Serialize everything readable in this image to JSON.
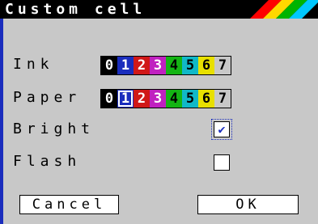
{
  "window": {
    "title": "Custom cell"
  },
  "colors": {
    "background": "#c8c8c8",
    "titlebar": "#000000",
    "accent": "#1a2dbd",
    "stripes": [
      "#ff0000",
      "#ffd800",
      "#00b400",
      "#00c8ff"
    ]
  },
  "ink": {
    "label": "Ink",
    "selected": "0",
    "swatches": [
      {
        "digit": "0",
        "bg": "#000000",
        "fg": "#ffffff"
      },
      {
        "digit": "1",
        "bg": "#1a2dbd",
        "fg": "#ffffff"
      },
      {
        "digit": "2",
        "bg": "#d01818",
        "fg": "#ffffff"
      },
      {
        "digit": "3",
        "bg": "#c020c0",
        "fg": "#ffffff"
      },
      {
        "digit": "4",
        "bg": "#14b414",
        "fg": "#000000"
      },
      {
        "digit": "5",
        "bg": "#10b8c8",
        "fg": "#000000"
      },
      {
        "digit": "6",
        "bg": "#e8e000",
        "fg": "#000000"
      },
      {
        "digit": "7",
        "bg": "#c8c8c8",
        "fg": "#000000"
      }
    ]
  },
  "paper": {
    "label": "Paper",
    "selected": "1",
    "swatches": [
      {
        "digit": "0",
        "bg": "#000000",
        "fg": "#ffffff"
      },
      {
        "digit": "1",
        "bg": "#1a2dbd",
        "fg": "#ffffff"
      },
      {
        "digit": "2",
        "bg": "#d01818",
        "fg": "#ffffff"
      },
      {
        "digit": "3",
        "bg": "#c020c0",
        "fg": "#ffffff"
      },
      {
        "digit": "4",
        "bg": "#14b414",
        "fg": "#000000"
      },
      {
        "digit": "5",
        "bg": "#10b8c8",
        "fg": "#000000"
      },
      {
        "digit": "6",
        "bg": "#e8e000",
        "fg": "#000000"
      },
      {
        "digit": "7",
        "bg": "#c8c8c8",
        "fg": "#000000"
      }
    ]
  },
  "bright": {
    "label": "Bright",
    "checked": true,
    "mark": "✔"
  },
  "flash": {
    "label": "Flash",
    "checked": false
  },
  "buttons": {
    "cancel": "Cancel",
    "ok": "OK"
  }
}
